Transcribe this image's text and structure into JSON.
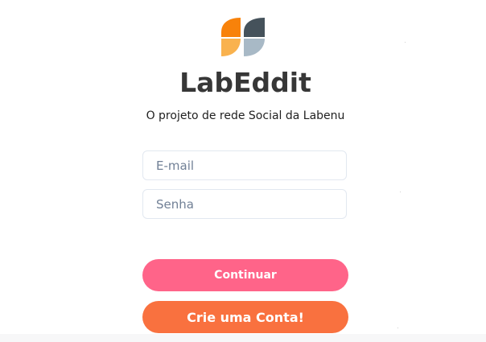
{
  "app": {
    "title": "LabEddit",
    "subtitle": "O projeto de rede Social da Labenu"
  },
  "logo": {
    "icon": "labenu-logo-icon",
    "colors": {
      "top_left": "#f8820a",
      "bottom_left": "#f9b24e",
      "top_right": "#45525b",
      "bottom_right": "#a8b9c6"
    }
  },
  "login_form": {
    "email_placeholder": "E-mail",
    "email_value": "",
    "password_placeholder": "Senha",
    "password_value": ""
  },
  "actions": {
    "continue_label": "Continuar",
    "signup_label": "Crie uma Conta!"
  },
  "colors": {
    "continue_button": "#ff6489",
    "signup_button": "#f9713f",
    "title_text": "#373737"
  }
}
